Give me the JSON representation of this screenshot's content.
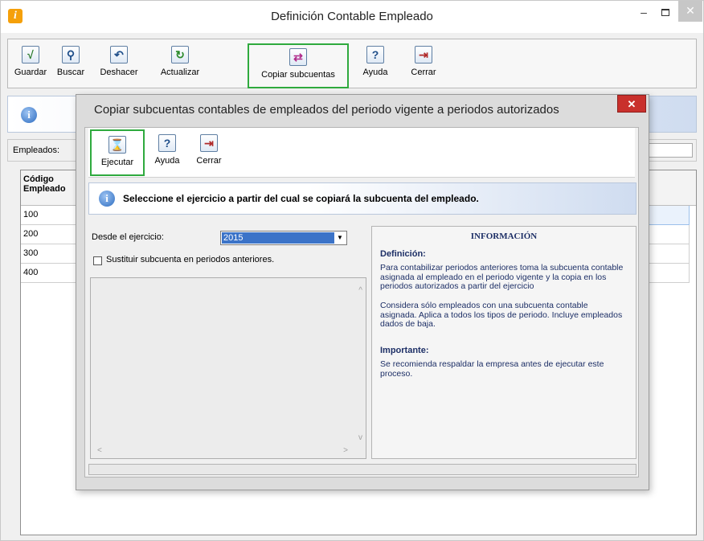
{
  "window": {
    "title": "Definición Contable Empleado",
    "app_icon_glyph": "i",
    "minimize": "–",
    "close": "✕"
  },
  "toolbar": {
    "items": [
      {
        "label": "Guardar",
        "icon": "check-icon",
        "glyph": "√"
      },
      {
        "label": "Buscar",
        "icon": "binoculars-icon",
        "glyph": "⚲"
      },
      {
        "label": "Deshacer",
        "icon": "undo-icon",
        "glyph": "↶"
      },
      {
        "label": "Actualizar",
        "icon": "refresh-icon",
        "glyph": "↻"
      },
      {
        "label": "Copiar subcuentas",
        "icon": "people-copy-icon",
        "glyph": "⇄"
      },
      {
        "label": "Ayuda",
        "icon": "help-icon",
        "glyph": "?"
      },
      {
        "label": "Cerrar",
        "icon": "exit-icon",
        "glyph": "⇥"
      }
    ]
  },
  "employees_label": "Empleados:",
  "grid": {
    "header": "Código Empleado",
    "rows": [
      "100",
      "200",
      "300",
      "400"
    ]
  },
  "dialog": {
    "title": "Copiar subcuentas contables de empleados del periodo vigente a periodos autorizados",
    "close": "✕",
    "toolbar": [
      {
        "label": "Ejecutar",
        "icon": "hourglass-icon",
        "glyph": "⌛"
      },
      {
        "label": "Ayuda",
        "icon": "help-icon",
        "glyph": "?"
      },
      {
        "label": "Cerrar",
        "icon": "exit-icon",
        "glyph": "⇥"
      }
    ],
    "info_message": "Seleccione el ejercicio a partir del cual se copiará la subcuenta del empleado.",
    "desde_label": "Desde el ejercicio:",
    "desde_value": "2015",
    "checkbox_label": "Sustituir subcuenta en periodos anteriores.",
    "info_panel": {
      "title": "INFORMACIÓN",
      "definicion_head": "Definición:",
      "definicion_text1": "Para contabilizar periodos anteriores toma la subcuenta contable asignada al empleado en el periodo vigente y la copia en los periodos autorizados a partir del ejercicio",
      "definicion_text2": "Considera sólo empleados con una subcuenta contable asignada.  Aplica a todos los tipos de periodo. Incluye empleados dados de baja.",
      "importante_head": "Importante:",
      "importante_text": "Se recomienda respaldar la empresa antes de ejecutar este proceso."
    }
  },
  "colors": {
    "highlight": "#2faa3e",
    "close_red": "#c9302c",
    "select_blue": "#3b73c8",
    "info_text": "#1d2f66"
  }
}
